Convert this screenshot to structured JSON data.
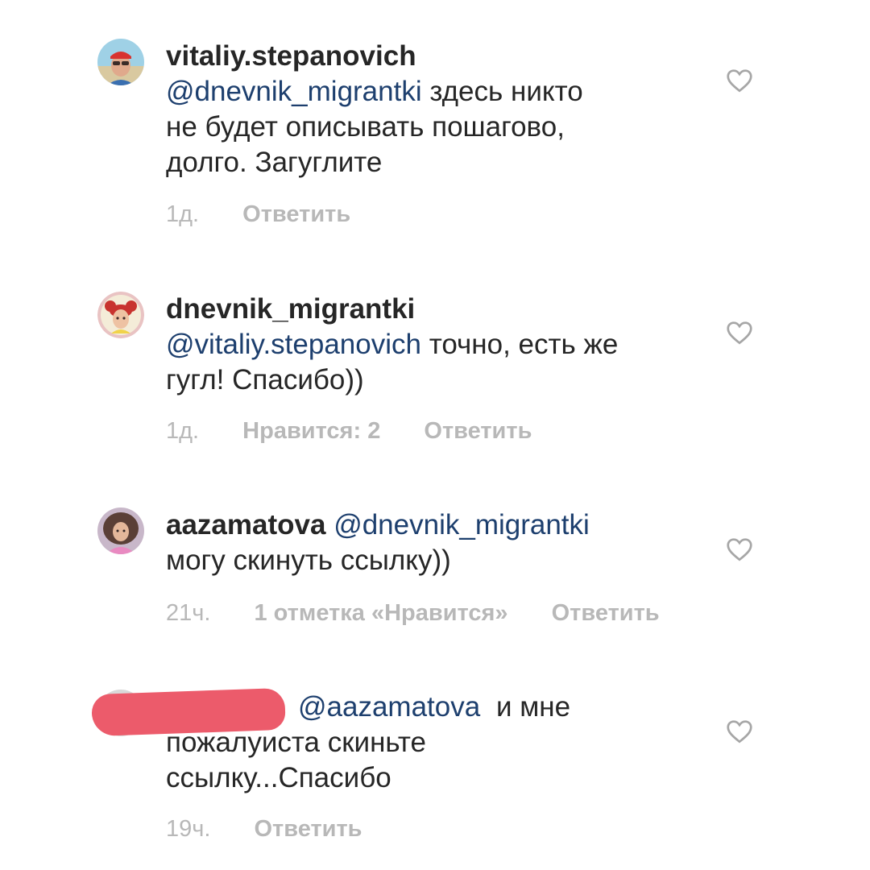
{
  "comments": [
    {
      "avatar_icon": "avatar-man-sunglasses",
      "username": "vitaliy.stepanovich",
      "mention": "@dnevnik_migrantki",
      "text": "здесь никто",
      "text_lines": [
        "не будет описывать пошагово,",
        "долго. Загуглите"
      ],
      "time": "1д.",
      "reply": "Ответить"
    },
    {
      "avatar_icon": "avatar-woman-red-hair",
      "username": "dnevnik_migrantki",
      "mention": "@vitaliy.stepanovich",
      "text": "точно, есть же",
      "text_lines": [
        "гугл! Спасибо))"
      ],
      "time": "1д.",
      "likes": "Нравится: 2",
      "reply": "Ответить"
    },
    {
      "avatar_icon": "avatar-woman-curly",
      "username": "aazamatova",
      "mention": "@dnevnik_migrantki",
      "text_lines": [
        "могу скинуть ссылку))"
      ],
      "time": "21ч.",
      "likes": "1 отметка «Нравится»",
      "reply": "Ответить"
    },
    {
      "avatar_icon": "avatar-redacted",
      "mention": "@aazamatova",
      "text": "и мне",
      "text_lines": [
        "пожалуиста скиньте",
        "ссылку...Спасибо"
      ],
      "time": "19ч.",
      "reply": "Ответить"
    }
  ],
  "colors": {
    "mention": "#1d3f6e",
    "meta": "#b8b8b8",
    "redaction": "#ec5b6b"
  }
}
